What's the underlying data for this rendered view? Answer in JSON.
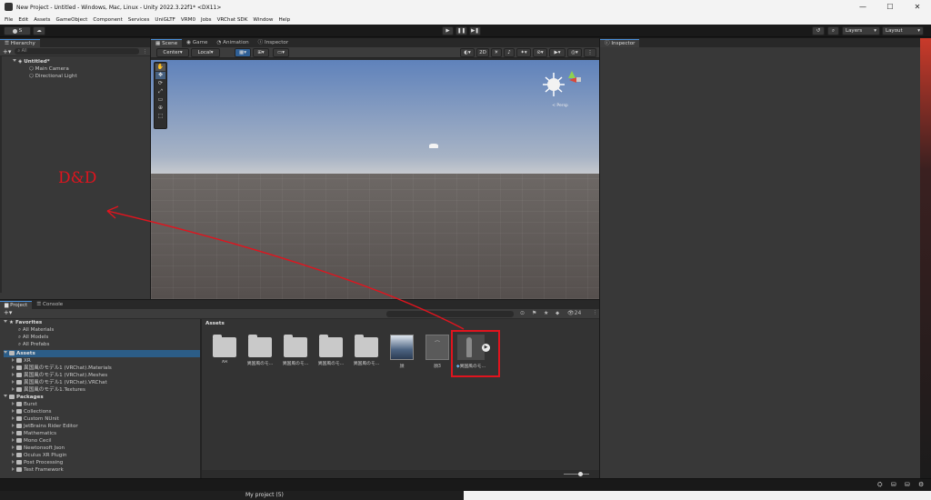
{
  "window": {
    "title": "New Project - Untitled - Windows, Mac, Linux - Unity 2022.3.22f1* <DX11>"
  },
  "menu": [
    "File",
    "Edit",
    "Assets",
    "GameObject",
    "Component",
    "Services",
    "UniGLTF",
    "VRM0",
    "Jobs",
    "VRChat SDK",
    "Window",
    "Help"
  ],
  "toolbar": {
    "account_label": "S",
    "layers_label": "Layers",
    "layout_label": "Layout"
  },
  "hierarchy": {
    "tab": "Hierarchy",
    "search_placeholder": "All",
    "scene": "Untitled*",
    "items": [
      "Main Camera",
      "Directional Light"
    ]
  },
  "scene_tabs": [
    "Scene",
    "Game",
    "Animation",
    "Inspector"
  ],
  "scene_toolbar": {
    "pivot": "Center",
    "space": "Local",
    "mode_2d": "2D",
    "gizmo_label": "< Persp"
  },
  "inspector": {
    "tab": "Inspector"
  },
  "annotation": {
    "text": "D&D"
  },
  "project": {
    "tabs": [
      "Project",
      "Console"
    ],
    "hidden_count": "24",
    "favorites_label": "Favorites",
    "favorites": [
      "All Materials",
      "All Models",
      "All Prefabs"
    ],
    "assets_label": "Assets",
    "assets_tree": [
      "XR",
      "異国風のモデル1 (VRChat).Materials",
      "異国風のモデル1 (VRChat).Meshes",
      "異国風のモデル1 (VRChat).VRChat",
      "異国風のモデル1.Textures"
    ],
    "packages_label": "Packages",
    "packages": [
      "Burst",
      "Collections",
      "Custom NUnit",
      "JetBrains Rider Editor",
      "Mathematics",
      "Mono Cecil",
      "Newtonsoft Json",
      "Oculus XR Plugin",
      "Post Processing",
      "Test Framework"
    ],
    "breadcrumb": "Assets",
    "grid": [
      "XR",
      "異国風のモ...",
      "異国風のモ...",
      "異国風のモ...",
      "異国風のモ...",
      "顔",
      "顔3",
      "異国風のモ..."
    ]
  },
  "taskbar": {
    "text": "My project (5)"
  }
}
